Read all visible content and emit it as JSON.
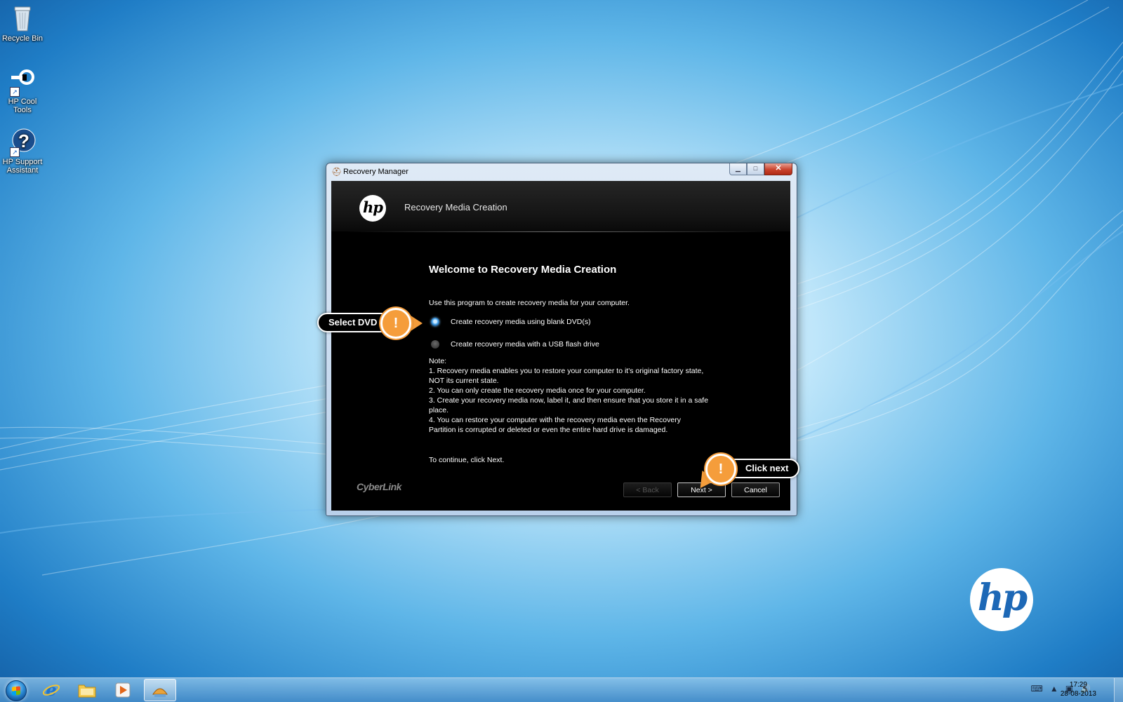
{
  "desktop": {
    "icons": [
      {
        "label": "Recycle Bin",
        "icon": "recycle-bin-icon"
      },
      {
        "label": "HP Cool Tools",
        "icon": "hp-cool-tools-icon"
      },
      {
        "label": "HP Support Assistant",
        "icon": "hp-support-assistant-icon"
      }
    ]
  },
  "window": {
    "title": "Recovery Manager",
    "header_title": "Recovery Media Creation",
    "logo_text": "hp",
    "welcome": "Welcome to Recovery Media Creation",
    "intro": "Use this program to create recovery media for your computer.",
    "options": [
      {
        "label": "Create recovery media using blank DVD(s)",
        "selected": true
      },
      {
        "label": "Create recovery media with a USB flash drive",
        "selected": false
      }
    ],
    "notes": [
      "Note:",
      "1. Recovery media enables you to restore your computer to it's original factory state,",
      "NOT its current state.",
      "2. You can only create the recovery media once for your computer.",
      "3. Create your recovery media now, label it, and then ensure that you store it in a safe",
      "place.",
      "4. You can restore your computer with the recovery media even the Recovery",
      "Partition is corrupted or deleted or even the entire hard drive is damaged."
    ],
    "continue_text": "To continue, click Next.",
    "brand": "CyberLink",
    "buttons": {
      "back": "< Back",
      "next": "Next >",
      "cancel": "Cancel"
    }
  },
  "callouts": {
    "select_dvd": "Select DVD",
    "click_next": "Click next",
    "badge": "!"
  },
  "wallpaper_logo": "hp",
  "taskbar": {
    "items": [
      "start-button",
      "internet-explorer-icon",
      "windows-explorer-icon",
      "media-player-icon",
      "recovery-manager-icon"
    ],
    "clock_time": "17:29",
    "clock_date": "28-08-2013"
  },
  "colors": {
    "accent_orange": "#f59d3b",
    "window_bg": "#000000",
    "desktop_blue": "#1f7dc6"
  }
}
